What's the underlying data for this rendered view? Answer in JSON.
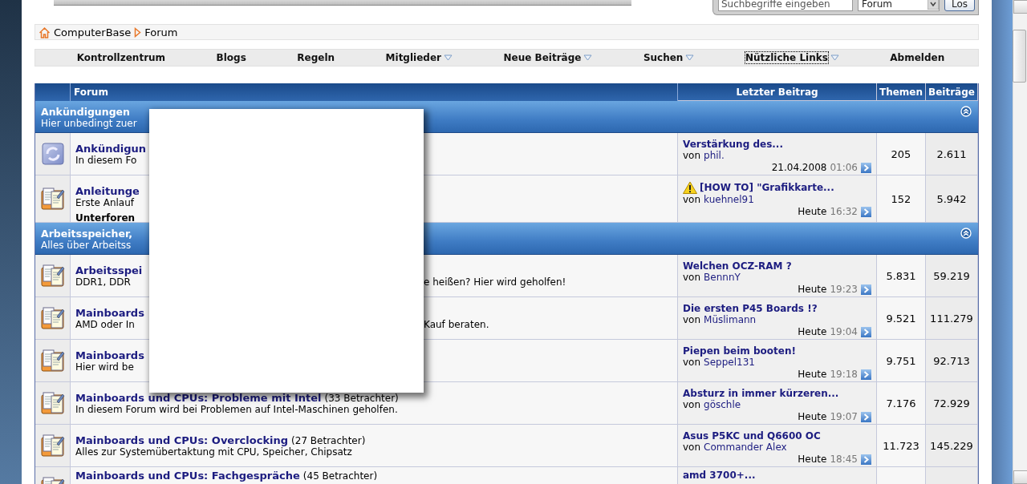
{
  "search": {
    "placeholder": "Suchbegriffe eingeben",
    "scope": "Forum",
    "button": "Los"
  },
  "breadcrumb": [
    "ComputerBase",
    "Forum"
  ],
  "nav": [
    {
      "label": "Kontrollzentrum",
      "dropdown": false,
      "focused": false
    },
    {
      "label": "Blogs",
      "dropdown": false,
      "focused": false
    },
    {
      "label": "Regeln",
      "dropdown": false,
      "focused": false
    },
    {
      "label": "Mitglieder",
      "dropdown": true,
      "focused": false
    },
    {
      "label": "Neue Beiträge",
      "dropdown": true,
      "focused": false
    },
    {
      "label": "Suchen",
      "dropdown": true,
      "focused": false
    },
    {
      "label": "Nützliche Links",
      "dropdown": true,
      "focused": true
    },
    {
      "label": "Abmelden",
      "dropdown": false,
      "focused": false
    }
  ],
  "table": {
    "columns": [
      "Forum",
      "Letzter Beitrag",
      "Themen",
      "Beiträge"
    ],
    "sections": [
      {
        "title": "Ankündigungen",
        "description": "Hier unbedingt zuer",
        "forums": [
          {
            "kind": "announcement",
            "title": "Ankündigun",
            "description": "In diesem Fo",
            "last_post": {
              "title": "Verstärkung des...",
              "warning": false,
              "by": "von",
              "author": "phil.",
              "date": "21.04.2008",
              "time": "01:06"
            },
            "threads": "205",
            "posts": "2.611"
          },
          {
            "kind": "forum",
            "title": "Anleitunge",
            "description": "Erste Anlauf",
            "subforums": "Unterforen",
            "last_post": {
              "title": "[HOW TO] \"Grafikkarte...",
              "warning": true,
              "by": "von",
              "author": "kuehnel91",
              "date": "Heute",
              "time": "16:32"
            },
            "threads": "152",
            "posts": "5.942"
          }
        ]
      },
      {
        "title": "Arbeitsspeicher,",
        "description": "Alles über Arbeitss",
        "forums": [
          {
            "kind": "forum",
            "title": "Arbeitsspei",
            "description": "DDR1, DDR",
            "description_right": "e heißen? Hier wird geholfen!",
            "last_post": {
              "title": "Welchen OCZ-RAM ?",
              "warning": false,
              "by": "von",
              "author": "BennnY",
              "date": "Heute",
              "time": "19:23"
            },
            "threads": "5.831",
            "posts": "59.219"
          },
          {
            "kind": "forum",
            "title": "Mainboards",
            "description": "AMD oder In",
            "description_right": "Kauf beraten.",
            "last_post": {
              "title": "Die ersten P45 Boards !?",
              "warning": false,
              "by": "von",
              "author": "Müslimann",
              "date": "Heute",
              "time": "19:04"
            },
            "threads": "9.521",
            "posts": "111.279"
          },
          {
            "kind": "forum",
            "title": "Mainboards",
            "description": "Hier wird be",
            "last_post": {
              "title": "Piepen beim booten!",
              "warning": false,
              "by": "von",
              "author": "Seppel131",
              "date": "Heute",
              "time": "19:18"
            },
            "threads": "9.751",
            "posts": "92.713"
          },
          {
            "kind": "forum",
            "title": "Mainboards und CPUs: Probleme mit Intel",
            "viewers": "(33 Betrachter)",
            "description": "In diesem Forum wird bei Problemen auf Intel-Maschinen geholfen.",
            "last_post": {
              "title": "Absturz in immer kürzeren...",
              "warning": false,
              "by": "von",
              "author": "göschle",
              "date": "Heute",
              "time": "19:07"
            },
            "threads": "7.176",
            "posts": "72.929"
          },
          {
            "kind": "forum",
            "title": "Mainboards und CPUs: Overclocking",
            "viewers": "(27 Betrachter)",
            "description": "Alles zur Systemübertaktung mit CPU, Speicher, Chipsatz",
            "last_post": {
              "title": "Asus P5KC und Q6600 OC",
              "warning": false,
              "by": "von",
              "author": "Commander Alex",
              "date": "Heute",
              "time": "18:45"
            },
            "threads": "11.723",
            "posts": "145.229"
          },
          {
            "kind": "forum",
            "title": "Mainboards und CPUs: Fachgespräche",
            "viewers": "(45 Betrachter)",
            "last_post": {
              "title": "amd 3700+...",
              "warning": false
            }
          }
        ]
      }
    ]
  }
}
